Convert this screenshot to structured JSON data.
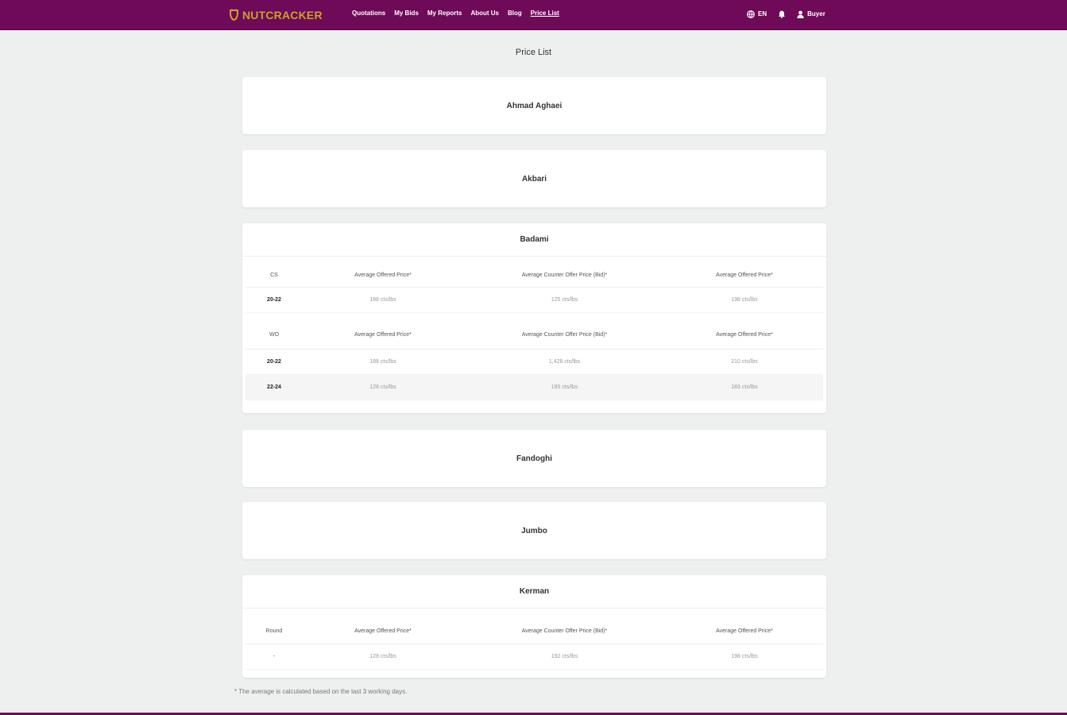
{
  "brand": {
    "name": "NUTCRACKER",
    "color": "#c9a227",
    "icon": "nut-icon"
  },
  "nav": [
    {
      "label": "Quotations"
    },
    {
      "label": "My Bids"
    },
    {
      "label": "My Reports"
    },
    {
      "label": "About Us"
    },
    {
      "label": "Blog"
    },
    {
      "label": "Price List",
      "active": true
    }
  ],
  "header_tools": {
    "language": "EN",
    "language_icon": "globe-icon",
    "notification_icon": "bell-icon",
    "user_icon": "user-icon",
    "user_label": "Buyer"
  },
  "page_title": "Price List",
  "sections": {
    "ahmad": {
      "title": "Ahmad Aghaei"
    },
    "akbari": {
      "title": "Akbari"
    },
    "badami": {
      "title": "Badami",
      "table1": {
        "headers": [
          "CS",
          "Average Offered Price*",
          "Average Counter Offer Price (Bid)*",
          "Average Offered Price*"
        ],
        "rows": [
          [
            "20-22",
            "188 cts/lbs",
            "125 cts/lbs",
            "198 cts/lbs"
          ]
        ]
      },
      "table2": {
        "headers": [
          "WO",
          "Average Offered Price*",
          "Average Counter Offer Price (Bid)*",
          "Average Offered Price*"
        ],
        "rows": [
          [
            "20-22",
            "188 cts/lbs",
            "1,428 cts/lbs",
            "210 cts/lbs"
          ],
          [
            "22-24",
            "128 cts/lbs",
            "195 cts/lbs",
            "183 cts/lbs"
          ]
        ]
      }
    },
    "fandoghi": {
      "title": "Fandoghi"
    },
    "jumbo": {
      "title": "Jumbo"
    },
    "kerman": {
      "title": "Kerman",
      "table": {
        "headers": [
          "Round",
          "Average Offered Price*",
          "Average Counter Offer Price (Bid)*",
          "Average Offered Price*"
        ],
        "rows": [
          [
            "-",
            "128 cts/lbs",
            "192 cts/lbs",
            "198 cts/lbs"
          ]
        ]
      }
    }
  },
  "footnote": "* The average is calculated based on the last 3 working days.",
  "colors": {
    "header_bg": "#6e0a58",
    "page_bg": "#eef0ef",
    "card_bg": "#ffffff"
  }
}
